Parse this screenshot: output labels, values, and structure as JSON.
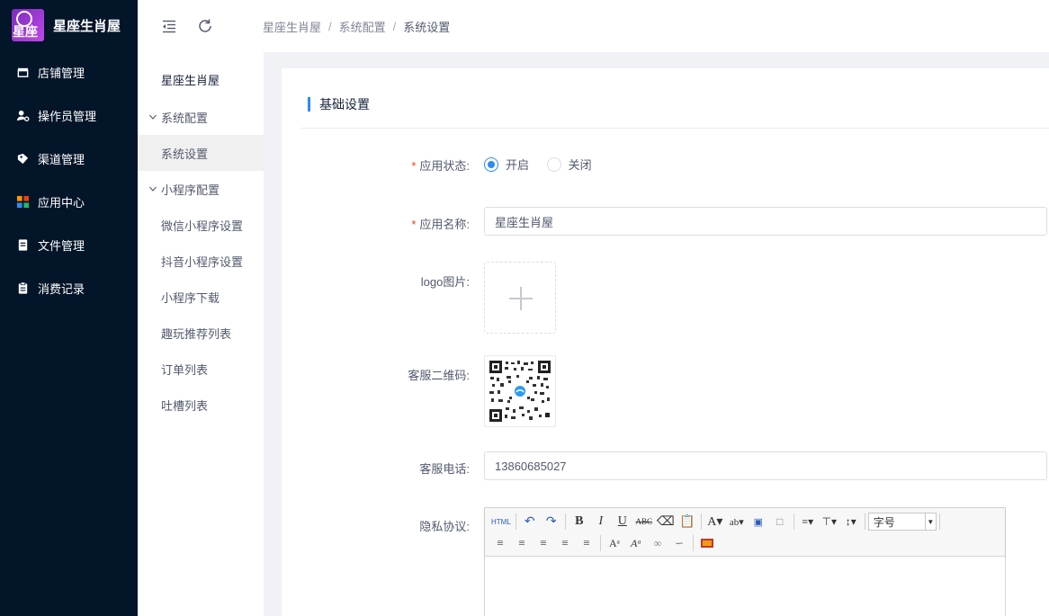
{
  "brand": {
    "name": "星座生肖屋",
    "logo_text": "星座"
  },
  "sidebar": {
    "items": [
      {
        "label": "店铺管理",
        "icon": "store-icon"
      },
      {
        "label": "操作员管理",
        "icon": "user-gear-icon"
      },
      {
        "label": "渠道管理",
        "icon": "tag-icon"
      },
      {
        "label": "应用中心",
        "icon": "grid-color-icon"
      },
      {
        "label": "文件管理",
        "icon": "file-icon"
      },
      {
        "label": "消费记录",
        "icon": "clipboard-icon"
      }
    ]
  },
  "header": {
    "collapse_icon": "menu-collapse-icon",
    "refresh_icon": "refresh-icon",
    "breadcrumb": [
      "星座生肖屋",
      "系统配置",
      "系统设置"
    ]
  },
  "submenu": {
    "title": "星座生肖屋",
    "group1": "系统配置",
    "group1_items": [
      "系统设置"
    ],
    "group2": "小程序配置",
    "group2_items": [
      "微信小程序设置",
      "抖音小程序设置",
      "小程序下载",
      "趣玩推荐列表",
      "订单列表",
      "吐槽列表"
    ]
  },
  "form": {
    "section_title": "基础设置",
    "status_label": "应用状态:",
    "status_on": "开启",
    "status_off": "关闭",
    "status_selected": "开启",
    "name_label": "应用名称:",
    "name_value": "星座生肖屋",
    "logo_label": "logo图片:",
    "qr_label": "客服二维码:",
    "phone_label": "客服电话:",
    "phone_value": "13860685027",
    "privacy_label": "隐私协议:",
    "editor_fontsize": "字号"
  },
  "colors": {
    "sidebar_bg": "#031529",
    "accent": "#2d8cf0",
    "required": "#ed4014"
  }
}
